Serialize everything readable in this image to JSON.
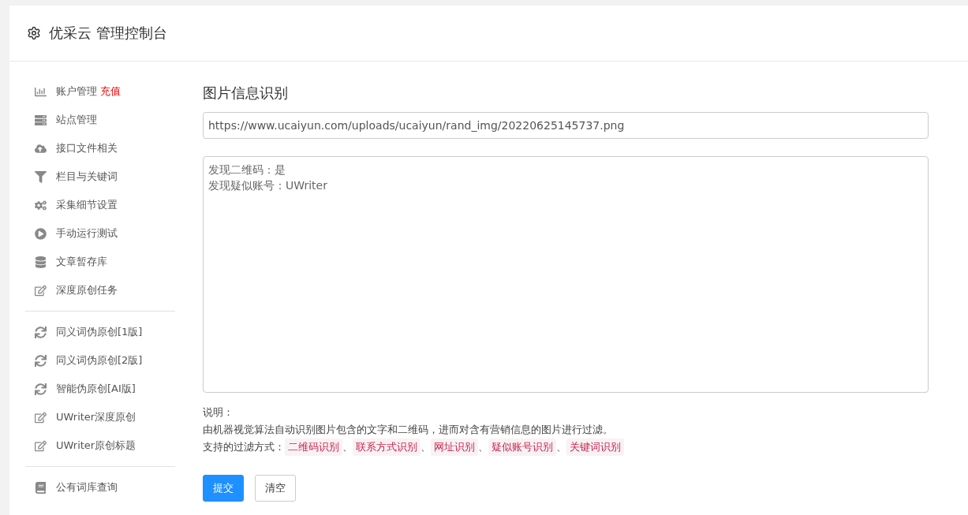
{
  "header": {
    "title": "优采云 管理控制台"
  },
  "sidebar": {
    "groups": [
      {
        "items": [
          {
            "label": "账户管理",
            "badge": "充值"
          },
          {
            "label": "站点管理"
          },
          {
            "label": "接口文件相关"
          },
          {
            "label": "栏目与关键词"
          },
          {
            "label": "采集细节设置"
          },
          {
            "label": "手动运行测试"
          },
          {
            "label": "文章暂存库"
          },
          {
            "label": "深度原创任务"
          }
        ]
      },
      {
        "items": [
          {
            "label": "同义词伪原创[1版]"
          },
          {
            "label": "同义词伪原创[2版]"
          },
          {
            "label": "智能伪原创[AI版]"
          },
          {
            "label": "UWriter深度原创"
          },
          {
            "label": "UWriter原创标题"
          }
        ]
      },
      {
        "items": [
          {
            "label": "公有词库查询"
          }
        ]
      }
    ]
  },
  "main": {
    "title": "图片信息识别",
    "url_field": {
      "value": "https://www.ucaiyun.com/uploads/ucaiyun/rand_img/20220625145737.png"
    },
    "result_box": {
      "lines": [
        "发现二维码：是",
        "发现疑似账号：UWriter"
      ]
    },
    "notes": {
      "label": "说明：",
      "description": "由机器视觉算法自动识别图片包含的文字和二维码，进而对含有营销信息的图片进行过滤。",
      "filters_label": "支持的过滤方式：",
      "separator": "、",
      "filters": [
        "二维码识别",
        "联系方式识别",
        "网址识别",
        "疑似账号识别",
        "关键词识别"
      ]
    },
    "buttons": [
      {
        "label": "提交",
        "kind": "primary"
      },
      {
        "label": "清空",
        "kind": "default"
      }
    ]
  }
}
